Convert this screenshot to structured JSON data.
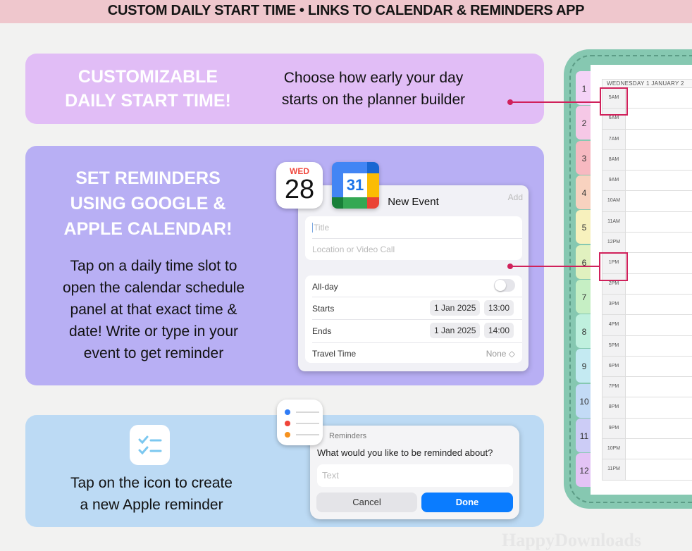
{
  "header": {
    "title": "CUSTOM DAILY START TIME  •  LINKS TO CALENDAR & REMINDERS APP"
  },
  "section_start_time": {
    "heading_lines": [
      "CUSTOMIZABLE",
      "DAILY START TIME!"
    ],
    "body_lines": [
      "Choose how early your day",
      "starts on the planner builder"
    ],
    "color": "#e1bdf6"
  },
  "section_reminders": {
    "heading_lines": [
      "SET REMINDERS",
      "USING GOOGLE &",
      "APPLE CALENDAR!"
    ],
    "body_lines": [
      "Tap on a daily time slot to",
      "open the calendar schedule",
      "panel at that exact time &",
      "date! Write or type in your",
      "event to get reminder"
    ],
    "color": "#b8aff4"
  },
  "section_apple_reminder": {
    "body_lines": [
      "Tap on the icon to create",
      "a new Apple reminder"
    ],
    "color": "#bcdaf4",
    "icon": "checklist-icon"
  },
  "apple_calendar_icon": {
    "day": "WED",
    "date": "28"
  },
  "google_calendar_icon": {
    "date": "31"
  },
  "new_event": {
    "title": "New Event",
    "add_label": "Add",
    "title_placeholder": "Title",
    "location_placeholder": "Location or Video Call",
    "all_day_label": "All-day",
    "all_day_on": false,
    "starts_label": "Starts",
    "starts_date": "1 Jan 2025",
    "starts_time": "13:00",
    "ends_label": "Ends",
    "ends_date": "1 Jan 2025",
    "ends_time": "14:00",
    "travel_label": "Travel Time",
    "travel_value": "None ◇"
  },
  "reminder_dialog": {
    "app_label": "Reminders",
    "question": "What would you like to be reminded about?",
    "placeholder": "Text",
    "cancel_label": "Cancel",
    "done_label": "Done",
    "accent": "#0a7cff"
  },
  "planner": {
    "date_header": "WEDNESDAY 1 JANUARY 2",
    "tabs": [
      "1",
      "2",
      "3",
      "4",
      "5",
      "6",
      "7",
      "8",
      "9",
      "10",
      "11",
      "12"
    ],
    "tab_colors": [
      "#f4d3f7",
      "#f6c8e6",
      "#f7b9c1",
      "#f8d2bf",
      "#f7f1bd",
      "#e1f1bf",
      "#c6efc4",
      "#bff0de",
      "#c4eaf2",
      "#c3dbf6",
      "#ccccf6",
      "#e3c3f5"
    ],
    "times": [
      "5AM",
      "6AM",
      "7AM",
      "8AM",
      "9AM",
      "10AM",
      "11AM",
      "12PM",
      "1PM",
      "2PM",
      "3PM",
      "4PM",
      "5PM",
      "6PM",
      "7PM",
      "8PM",
      "9PM",
      "10PM",
      "11PM"
    ],
    "highlighted_times": [
      "5AM",
      "1PM"
    ],
    "frame_color": "#86c8b1"
  },
  "watermark": "HappyDownloads"
}
